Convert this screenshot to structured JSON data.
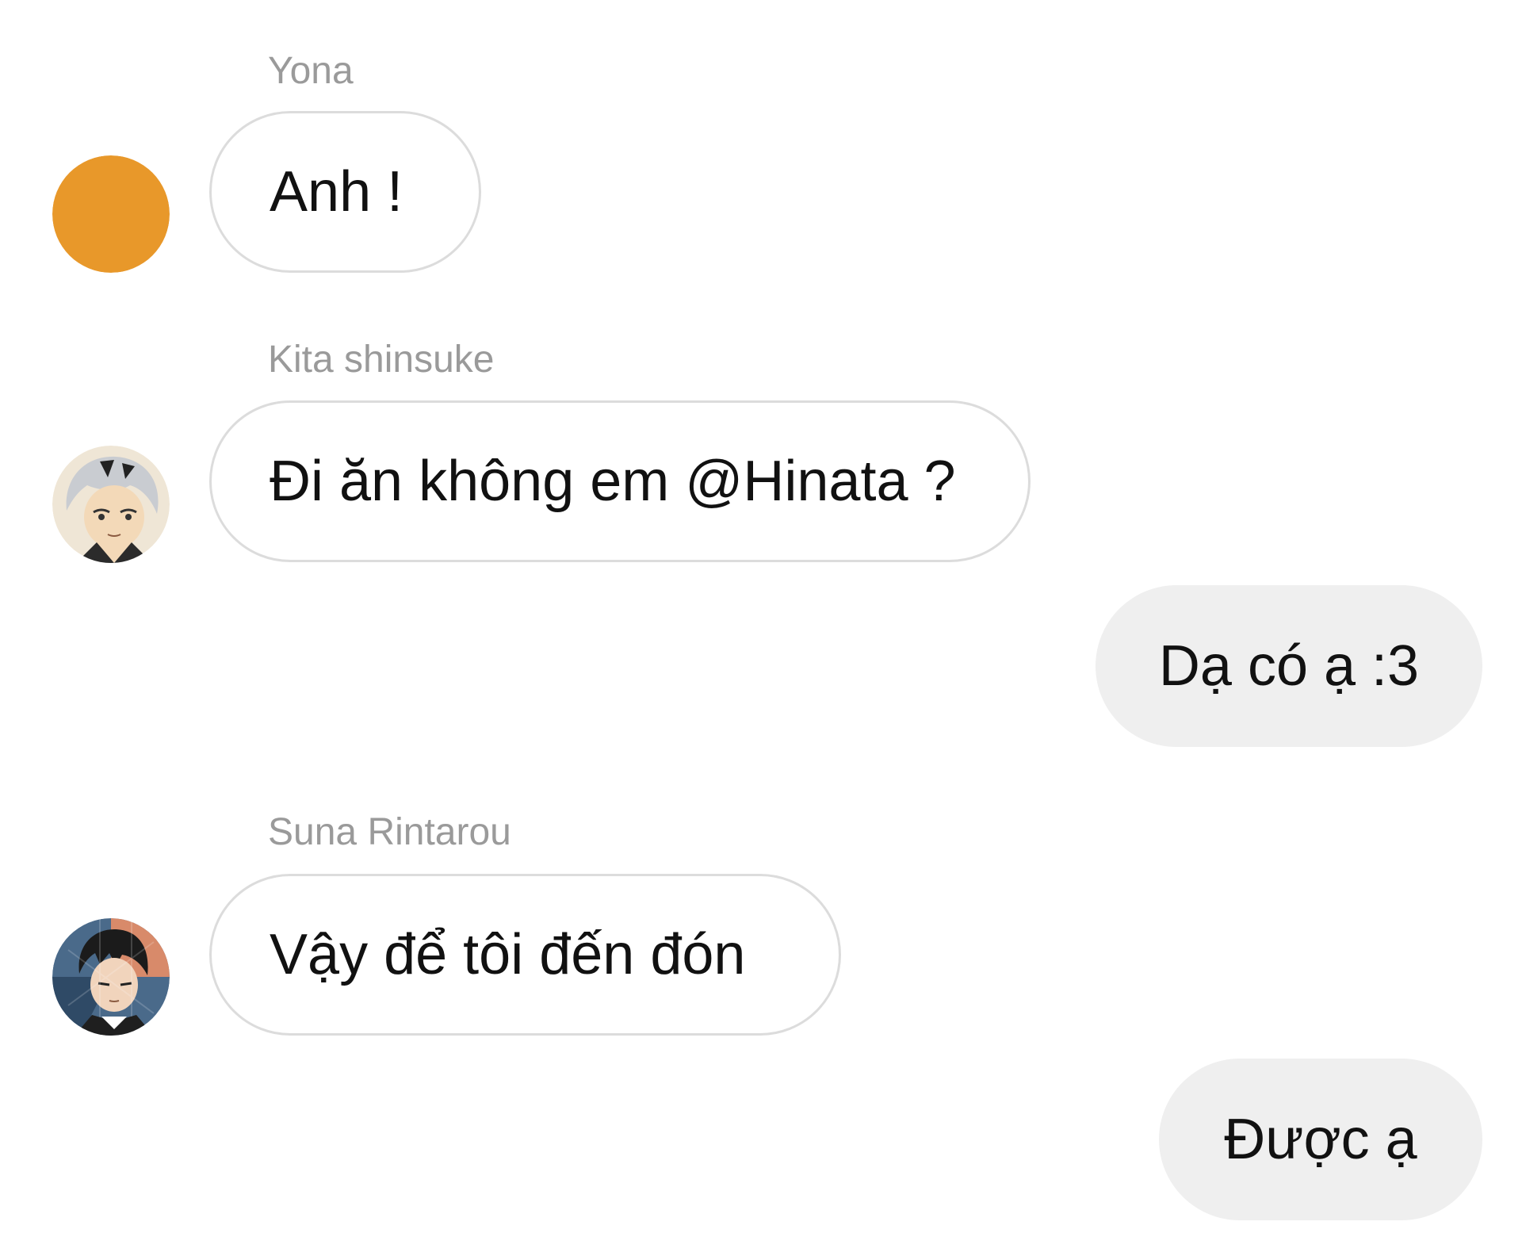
{
  "messages": [
    {
      "sender": "Yona",
      "text": "Anh !",
      "direction": "incoming",
      "avatar": "orange-circle-avatar"
    },
    {
      "sender": "Kita shinsuke",
      "text": "Đi ăn không em @Hinata ?",
      "direction": "incoming",
      "avatar": "kita-avatar"
    },
    {
      "sender": "",
      "text": "Dạ có ạ :3",
      "direction": "outgoing"
    },
    {
      "sender": "Suna Rintarou",
      "text": "Vậy để tôi đến đón",
      "direction": "incoming",
      "avatar": "suna-avatar"
    },
    {
      "sender": "",
      "text": "Được ạ",
      "direction": "outgoing"
    }
  ],
  "colors": {
    "yona_avatar": "#E8982A",
    "incoming_bubble_border": "#DCDCDC",
    "outgoing_bubble_bg": "#EFEFEF",
    "sender_name": "#9A9A9A",
    "message_text": "#111111"
  }
}
